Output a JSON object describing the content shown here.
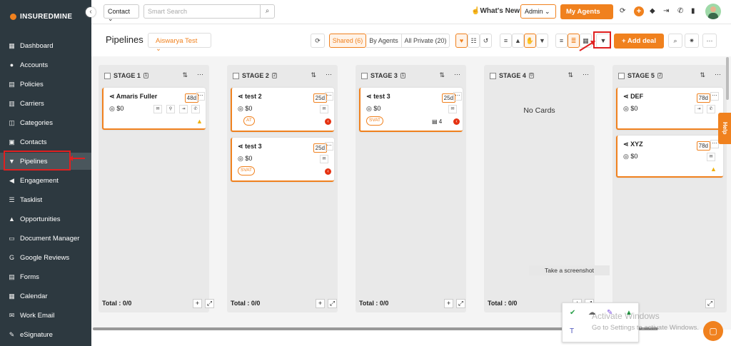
{
  "sidebar": {
    "brand": "INSUREDMINE",
    "collapse_icon": "chevron-left-icon",
    "items": [
      {
        "label": "Dashboard",
        "icon": "dashboard-icon"
      },
      {
        "label": "Accounts",
        "icon": "accounts-icon"
      },
      {
        "label": "Policies",
        "icon": "policies-icon"
      },
      {
        "label": "Carriers",
        "icon": "carriers-icon"
      },
      {
        "label": "Categories",
        "icon": "categories-icon"
      },
      {
        "label": "Contacts",
        "icon": "contacts-icon"
      },
      {
        "label": "Pipelines",
        "icon": "pipelines-icon",
        "active": true
      },
      {
        "label": "Engagement",
        "icon": "engagement-icon"
      },
      {
        "label": "Tasklist",
        "icon": "tasklist-icon"
      },
      {
        "label": "Opportunities",
        "icon": "opportunities-icon"
      },
      {
        "label": "Document Manager",
        "icon": "folder-icon"
      },
      {
        "label": "Google Reviews",
        "icon": "google-icon"
      },
      {
        "label": "Forms",
        "icon": "forms-icon"
      },
      {
        "label": "Calendar",
        "icon": "calendar-icon"
      },
      {
        "label": "Work Email",
        "icon": "email-icon"
      },
      {
        "label": "eSignature",
        "icon": "signature-icon"
      }
    ]
  },
  "topbar": {
    "contact_select": "Contact",
    "search_placeholder": "Smart Search",
    "whats_new": "What's New",
    "admin_select": "Admin",
    "my_agents": "My Agents"
  },
  "pipeline_bar": {
    "title": "Pipelines",
    "pipeline_select": "Aiswarya Test",
    "shared": "Shared (6)",
    "by_agents": "By Agents",
    "all_private": "All Private (20)",
    "add_deal": "Add deal"
  },
  "stages": [
    {
      "title": "STAGE 1",
      "count": "1",
      "total": "Total : 0/0",
      "cards": [
        {
          "name": "Amaris Fuller",
          "amount": "$0",
          "age": "48d"
        }
      ]
    },
    {
      "title": "STAGE 2",
      "count": "2",
      "total": "Total : 0/0",
      "cards": [
        {
          "name": "test 2",
          "amount": "$0",
          "age": "25d",
          "avatar": "AT"
        },
        {
          "name": "test 3",
          "amount": "$0",
          "age": "25d",
          "avatar": "SVAT"
        }
      ]
    },
    {
      "title": "STAGE 3",
      "count": "1",
      "total": "Total : 0/0",
      "cards": [
        {
          "name": "test 3",
          "amount": "$0",
          "age": "25d",
          "avatar": "SVAT",
          "notes": "4"
        }
      ]
    },
    {
      "title": "STAGE 4",
      "count": "0",
      "total": "Total : 0/0",
      "empty_text": "No Cards",
      "cards": []
    },
    {
      "title": "STAGE 5",
      "count": "2",
      "total": "",
      "cards": [
        {
          "name": "DEF",
          "amount": "$0",
          "age": "78d"
        },
        {
          "name": "XYZ",
          "amount": "$0",
          "age": "78d"
        }
      ]
    }
  ],
  "overlay": {
    "screenshot_tip": "Take a screenshot",
    "activate_title": "Activate Windows",
    "activate_sub": "Go to Settings to activate Windows.",
    "help": "Help"
  },
  "colors": {
    "accent": "#f0811e",
    "sidebar": "#2d3940",
    "annotation": "#e02020"
  }
}
